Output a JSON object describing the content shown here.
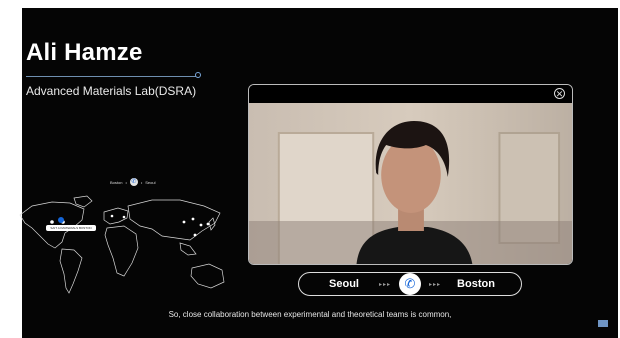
{
  "presenter": {
    "name": "Ali Hamze",
    "affiliation": "Advanced Materials Lab(DSRA)"
  },
  "map": {
    "route_from": "Boston",
    "route_to": "Seoul",
    "pin_label": "SAIT AI MATERIALS BOSTON"
  },
  "video": {
    "close_icon": "close-icon"
  },
  "call": {
    "from": "Seoul",
    "to": "Boston",
    "arrows_left": "▸▸▸",
    "arrows_right": "▸▸▸",
    "phone_glyph": "✆"
  },
  "caption": "So, close collaboration between experimental and theoretical teams is common,",
  "colors": {
    "background": "#050505",
    "accent": "#1465d8"
  }
}
